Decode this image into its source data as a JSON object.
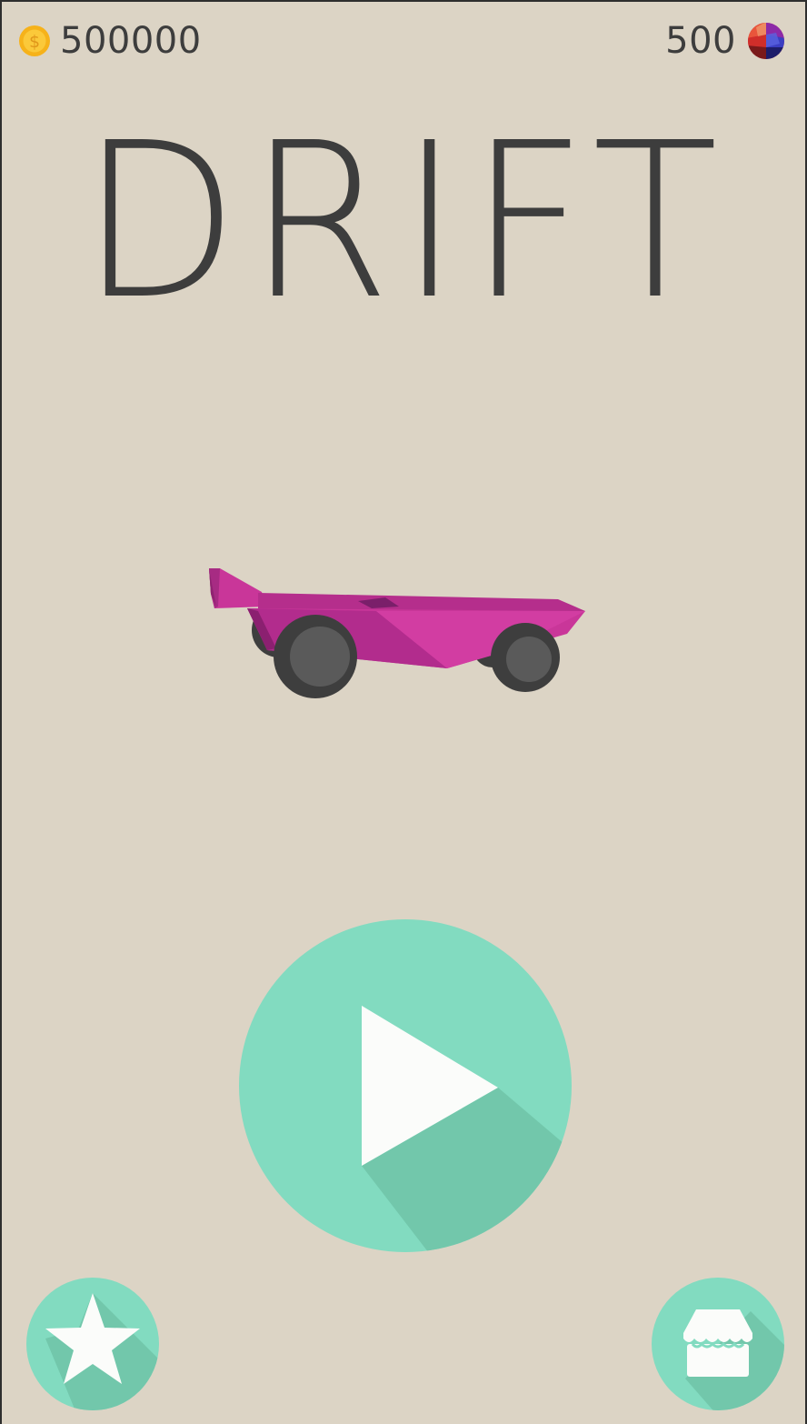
{
  "hud": {
    "coins": "500000",
    "gems": "500",
    "coin_icon": "coin-icon",
    "gem_icon": "gem-ball-icon"
  },
  "game": {
    "title": "DRIFT",
    "car": "pink-race-car"
  },
  "buttons": {
    "play_icon": "play-icon",
    "leaderboard_icon": "star-icon",
    "shop_icon": "shop-icon"
  },
  "colors": {
    "background": "#dcd4c5",
    "text": "#3d3d3d",
    "button_teal": "#82dbc0",
    "button_shadow": "#72c7ab",
    "car_pink": "#c93699",
    "coin_gold": "#f6b21a"
  }
}
